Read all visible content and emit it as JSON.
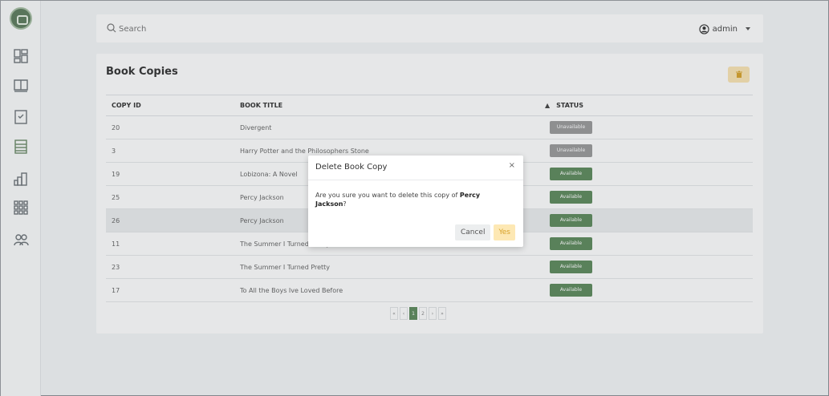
{
  "colors": {
    "accent": "#5e8a5c",
    "unavailable": "#9a9a9a",
    "warning": "#fde8b4"
  },
  "sidebar": {
    "logo_icon": "library-logo-icon",
    "items": [
      {
        "icon": "dashboard-icon"
      },
      {
        "icon": "book-icon"
      },
      {
        "icon": "bookmark-icon"
      },
      {
        "icon": "book-copies-icon",
        "active": true
      },
      {
        "icon": "building-icon"
      },
      {
        "icon": "grid-icon"
      },
      {
        "icon": "users-icon"
      }
    ]
  },
  "header": {
    "search_placeholder": "Search",
    "user_label": "admin"
  },
  "card": {
    "title": "Book Copies",
    "delete_icon": "trash-icon"
  },
  "table": {
    "columns": [
      "COPY ID",
      "BOOK TITLE",
      "STATUS"
    ],
    "rows": [
      {
        "id": "20",
        "title": "Divergent",
        "status": "Unavailable"
      },
      {
        "id": "3",
        "title": "Harry Potter and the Philosophers Stone",
        "status": "Unavailable"
      },
      {
        "id": "19",
        "title": "Lobizona: A Novel",
        "status": "Available"
      },
      {
        "id": "25",
        "title": "Percy Jackson",
        "status": "Available"
      },
      {
        "id": "26",
        "title": "Percy Jackson",
        "status": "Available"
      },
      {
        "id": "11",
        "title": "The Summer I Turned Pretty",
        "status": "Available"
      },
      {
        "id": "23",
        "title": "The Summer I Turned Pretty",
        "status": "Available"
      },
      {
        "id": "17",
        "title": "To All the Boys Ive Loved Before",
        "status": "Available"
      }
    ]
  },
  "pagination": {
    "first": "«",
    "prev": "‹",
    "pages": [
      "1",
      "2"
    ],
    "next": "›",
    "last": "»",
    "current": "1"
  },
  "modal": {
    "title": "Delete Book Copy",
    "close": "×",
    "message_prefix": "Are you sure you want to delete this copy of ",
    "book_title": "Percy Jackson",
    "message_suffix": "?",
    "cancel_label": "Cancel",
    "confirm_label": "Yes"
  }
}
